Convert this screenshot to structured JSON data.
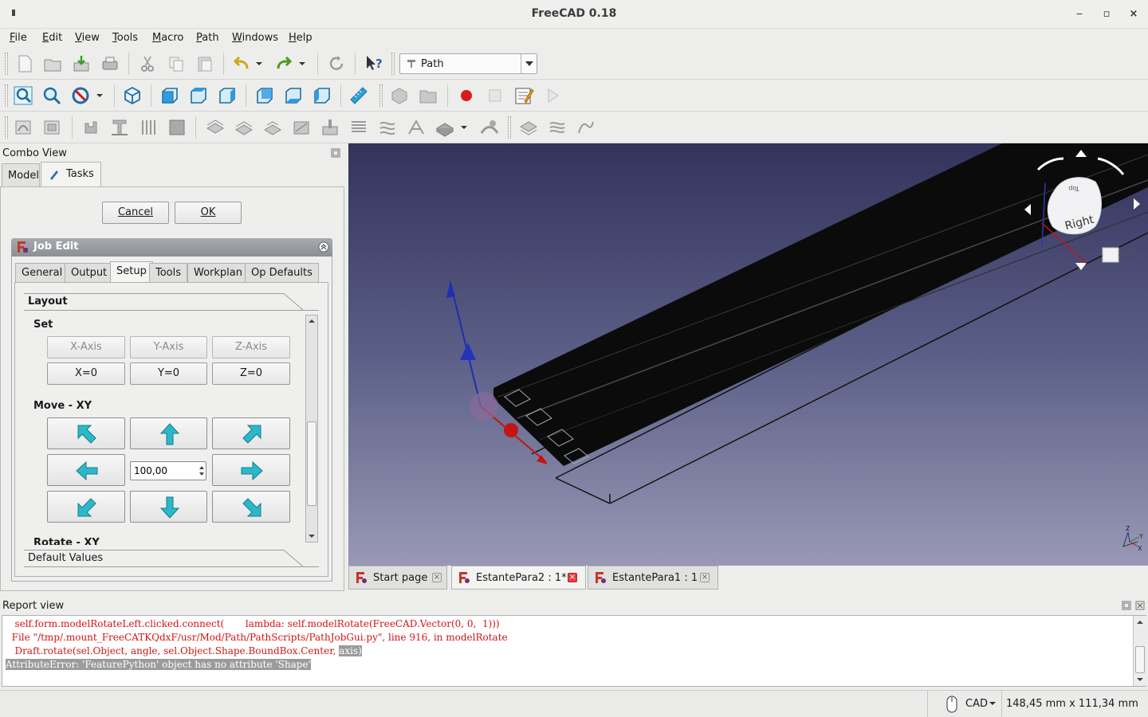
{
  "window": {
    "title": "FreeCAD 0.18",
    "minimize": "‒",
    "maximize": "▫",
    "close": "×"
  },
  "menu": [
    {
      "u": "F",
      "rest": "ile"
    },
    {
      "u": "E",
      "rest": "dit"
    },
    {
      "u": "V",
      "rest": "iew"
    },
    {
      "u": "T",
      "rest": "ools"
    },
    {
      "u": "M",
      "rest": "acro"
    },
    {
      "u": "P",
      "rest": "ath"
    },
    {
      "u": "W",
      "rest": "indows"
    },
    {
      "u": "H",
      "rest": "elp"
    }
  ],
  "workbench": {
    "selected": "Path"
  },
  "combo_view": {
    "title": "Combo View",
    "tabs": [
      "Model",
      "Tasks"
    ],
    "cancel_label": "Cancel",
    "ok_label": "OK"
  },
  "job_edit": {
    "title": "Job Edit",
    "tabs": [
      "General",
      "Output",
      "Setup",
      "Tools",
      "Workplan",
      "Op Defaults"
    ],
    "active_tab": "Setup",
    "layout_label": "Layout",
    "set_label": "Set",
    "axis_buttons": [
      "X-Axis",
      "Y-Axis",
      "Z-Axis"
    ],
    "zero_buttons": [
      "X=0",
      "Y=0",
      "Z=0"
    ],
    "move_label": "Move - XY",
    "move_step": "100,00",
    "rotate_label": "Rotate - XY",
    "default_values_label": "Default Values"
  },
  "view3d": {
    "navcube_face": "Right",
    "navcube_top": "Top",
    "axis_labels": [
      "Z",
      "Y",
      "X"
    ]
  },
  "doc_tabs": [
    {
      "label": "Start page",
      "active": false
    },
    {
      "label": "EstantePara2 : 1*",
      "active": true
    },
    {
      "label": "EstantePara1 : 1",
      "active": false
    }
  ],
  "report_view": {
    "title": "Report view",
    "lines": [
      "   self.form.modelRotateLeft.clicked.connect(       lambda: self.modelRotate(FreeCAD.Vector(0, 0,  1)))",
      "  File \"/tmp/.mount_FreeCATKQdxF/usr/Mod/Path/PathScripts/PathJobGui.py\", line 916, in modelRotate",
      "   Draft.rotate(sel.Object, angle, sel.Object.Shape.BoundBox.Center, ",
      "AttributeError: 'FeaturePython' object has no attribute 'Shape'"
    ],
    "highlight": "axis)"
  },
  "statusbar": {
    "nav_style": "CAD",
    "dimensions": "148,45 mm x 111,34 mm"
  },
  "colors": {
    "accent_arrow": "#29b3c7",
    "error_text": "#d21414"
  }
}
